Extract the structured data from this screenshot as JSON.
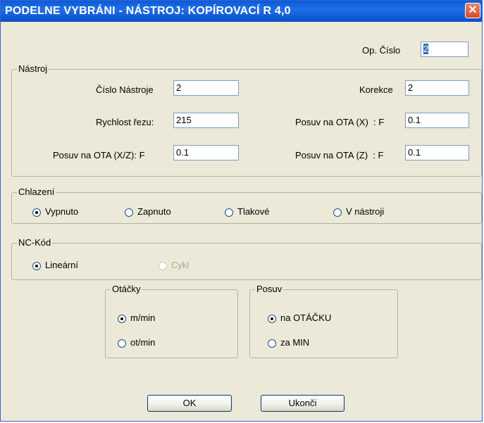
{
  "window": {
    "title": "PODELNE VYBRÁNI - NÁSTROJ: KOPÍROVACÍ R 4,0",
    "close_glyph": "✕",
    "close_icon": "close-icon"
  },
  "op_cislo": {
    "label": "Op. Číslo",
    "value": "2"
  },
  "nastroj": {
    "title": "Nástroj",
    "cislo_nastroje": {
      "label": "Číslo Nástroje",
      "value": "2"
    },
    "korekce": {
      "label": "Korekce",
      "value": "2"
    },
    "rychlost_rezu": {
      "label": "Rychlost řezu:",
      "value": "215"
    },
    "posuv_x": {
      "label": "Posuv na OTA (X)  : F",
      "value": "0.1"
    },
    "posuv_xz": {
      "label": "Posuv na OTA (X/Z): F",
      "value": "0.1"
    },
    "posuv_z": {
      "label": "Posuv na OTA (Z)  : F",
      "value": "0.1"
    }
  },
  "chlazeni": {
    "title": "Chlazení",
    "options": [
      {
        "label": "Vypnuto",
        "selected": true
      },
      {
        "label": "Zapnuto",
        "selected": false
      },
      {
        "label": "Tlakové",
        "selected": false
      },
      {
        "label": "V nástroji",
        "selected": false
      }
    ]
  },
  "nc_kod": {
    "title": "NC-Kód",
    "options": [
      {
        "label": "Lineární",
        "selected": true,
        "enabled": true
      },
      {
        "label": "Cykl",
        "selected": false,
        "enabled": false
      }
    ]
  },
  "otacky": {
    "title": "Otáčky",
    "options": [
      {
        "label": "m/min",
        "selected": true
      },
      {
        "label": "ot/min",
        "selected": false
      }
    ]
  },
  "posuv": {
    "title": "Posuv",
    "options": [
      {
        "label": "na OTÁČKU",
        "selected": true
      },
      {
        "label": "za MIN",
        "selected": false
      }
    ]
  },
  "buttons": {
    "ok": "OK",
    "cancel": "Ukonči"
  }
}
